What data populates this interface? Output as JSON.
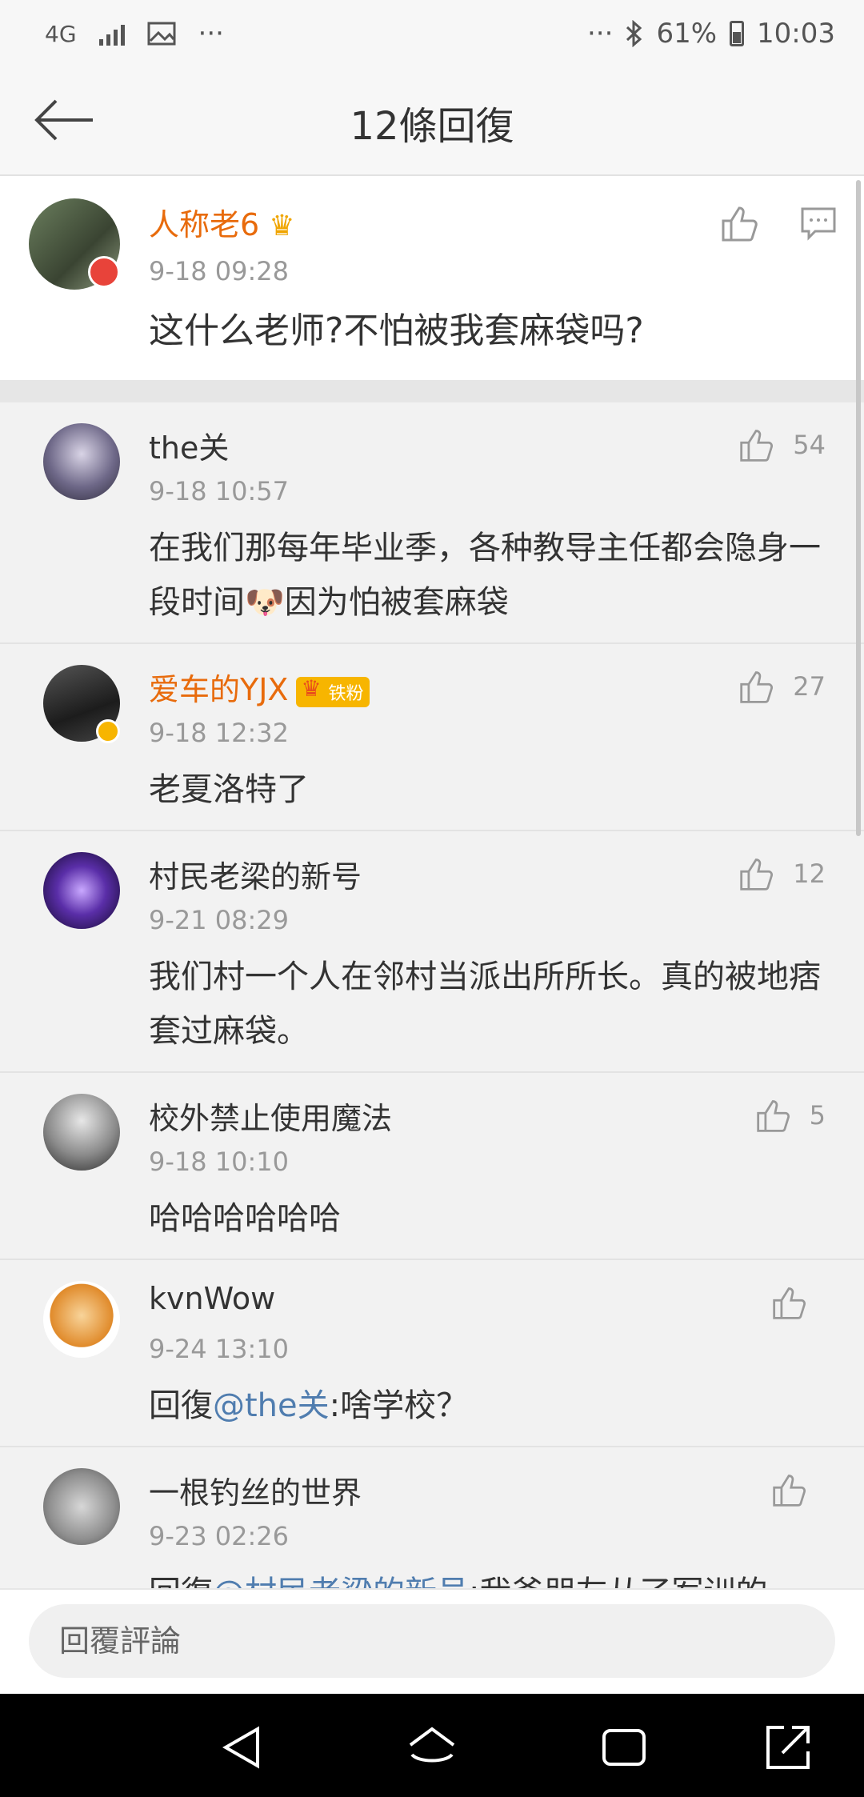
{
  "status": {
    "network": "4G",
    "dots": "···",
    "battery": "61%",
    "time": "10:03"
  },
  "header": {
    "title": "12條回復"
  },
  "main_comment": {
    "name": "人称老6",
    "time": "9-18 09:28",
    "text": "这什么老师?不怕被我套麻袋吗?"
  },
  "replies": [
    {
      "name": "the关",
      "time": "9-18 10:57",
      "text": "在我们那每年毕业季，各种教导主任都会隐身一段时间🐶因为怕被套麻袋",
      "likes": "54"
    },
    {
      "name": "爱车的YJX",
      "fan_badge": "铁粉",
      "time": "9-18 12:32",
      "text": "老夏洛特了",
      "likes": "27"
    },
    {
      "name": "村民老梁的新号",
      "time": "9-21 08:29",
      "text": "我们村一个人在邻村当派出所所长。真的被地痞套过麻袋。",
      "likes": "12"
    },
    {
      "name": "校外禁止使用魔法",
      "time": "9-18 10:10",
      "text": "哈哈哈哈哈哈",
      "likes": "5"
    },
    {
      "name": "kvnWow",
      "time": "9-24 13:10",
      "text_prefix": "回復",
      "mention": "@the关",
      "text_suffix": ":啥学校？",
      "likes": ""
    },
    {
      "name": "一根钓丝的世界",
      "time": "9-23 02:26",
      "text_prefix": "回復",
      "mention": "@村民老梁的新号",
      "text_suffix": ":我爸朋友从了军训的",
      "likes": ""
    }
  ],
  "input": {
    "placeholder": "回覆評論"
  },
  "colors": {
    "accent_orange": "#e86b0c",
    "mention_blue": "#507daf",
    "time_gray": "#999999"
  }
}
